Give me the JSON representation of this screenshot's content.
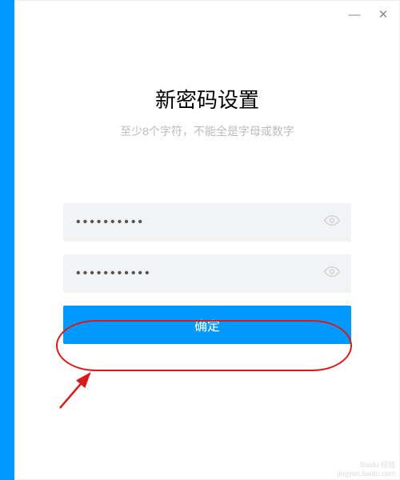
{
  "window": {
    "minimize": "—",
    "close": "✕"
  },
  "title": "新密码设置",
  "subtitle": "至少8个字符，不能全是字母或数字",
  "password1": {
    "value": "••••••••••"
  },
  "password2": {
    "value": "•••••••••••"
  },
  "confirmLabel": "确定",
  "watermark": {
    "line1": "Baidu 经验",
    "line2": "jingyan.baidu.com"
  }
}
